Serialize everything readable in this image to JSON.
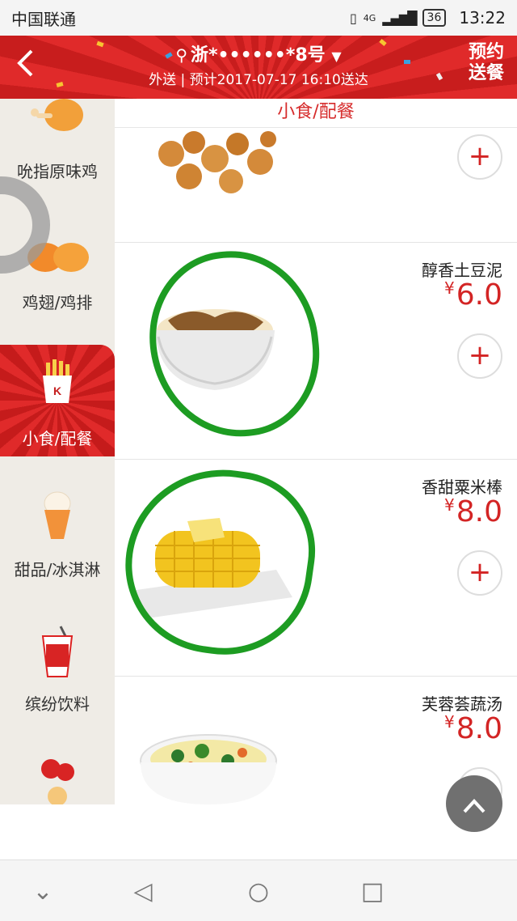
{
  "status_bar": {
    "carrier": "中国联通",
    "network": "4G",
    "battery": "36",
    "time": "13:22"
  },
  "header": {
    "back_icon": "chevron-left-icon",
    "address": "浙*••••••*8号",
    "dropdown_icon": "triangle-down-icon",
    "delivery_info": "外送 | 预计2017-07-17 16:10送达",
    "reserve_label_line1": "预约",
    "reserve_label_line2": "送餐",
    "accent_color": "#d92626"
  },
  "sidebar": {
    "categories": [
      {
        "label": "吮指原味鸡",
        "icon": "chicken-drumstick-icon",
        "active": false
      },
      {
        "label": "鸡翅/鸡排",
        "icon": "chicken-wing-icon",
        "active": false
      },
      {
        "label": "小食/配餐",
        "icon": "kfc-fries-box-icon",
        "active": true
      },
      {
        "label": "甜品/冰淇淋",
        "icon": "ice-cream-cone-icon",
        "active": false
      },
      {
        "label": "缤纷饮料",
        "icon": "drink-cup-icon",
        "active": false
      },
      {
        "label": "",
        "icon": "balloons-icon",
        "active": false
      }
    ]
  },
  "main": {
    "section_title": "小食/配餐",
    "items": [
      {
        "name": "",
        "price": "",
        "image": "popcorn-chicken-image",
        "add_label": "+"
      },
      {
        "name": "醇香土豆泥",
        "price": "6.0",
        "currency": "¥",
        "image": "mashed-potato-image",
        "add_label": "+"
      },
      {
        "name": "香甜粟米棒",
        "price": "8.0",
        "currency": "¥",
        "image": "corn-cob-image",
        "add_label": "+"
      },
      {
        "name": "芙蓉荟蔬汤",
        "price": "8.0",
        "currency": "¥",
        "image": "vegetable-soup-image",
        "add_label": "+"
      }
    ]
  },
  "scroll_top": {
    "icon": "chevron-up-icon",
    "label": "^"
  },
  "nav_bar": {
    "buttons": [
      {
        "icon": "chevron-down-icon",
        "glyph": "⌄"
      },
      {
        "icon": "back-triangle-icon",
        "glyph": "◁"
      },
      {
        "icon": "home-circle-icon",
        "glyph": "○"
      },
      {
        "icon": "recents-square-icon",
        "glyph": "□"
      }
    ]
  }
}
